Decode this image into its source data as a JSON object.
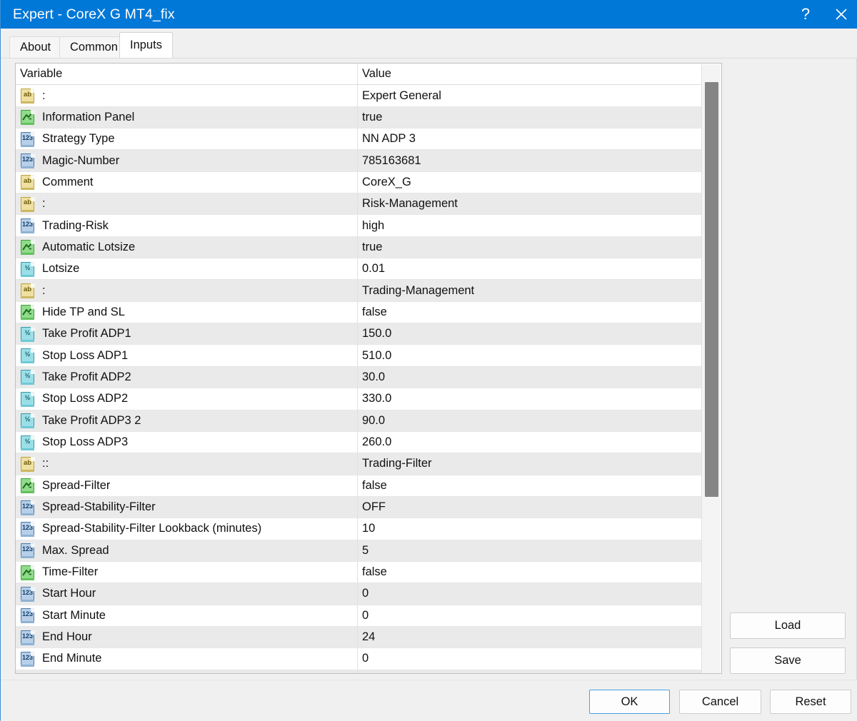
{
  "window": {
    "title": "Expert - CoreX G MT4_fix",
    "help_label": "?",
    "close_label": "close-icon",
    "accent_color": "#0078d7"
  },
  "tabs": [
    {
      "label": "About",
      "active": false
    },
    {
      "label": "Common",
      "active": false
    },
    {
      "label": "Inputs",
      "active": true
    }
  ],
  "table": {
    "headers": {
      "variable": "Variable",
      "value": "Value"
    },
    "rows": [
      {
        "icon": "string",
        "variable": ":",
        "value": "Expert General"
      },
      {
        "icon": "bool",
        "variable": "Information Panel",
        "value": "true"
      },
      {
        "icon": "int",
        "variable": "Strategy Type",
        "value": "NN ADP 3"
      },
      {
        "icon": "int",
        "variable": "Magic-Number",
        "value": "785163681"
      },
      {
        "icon": "string",
        "variable": "Comment",
        "value": "CoreX_G"
      },
      {
        "icon": "string",
        "variable": ":",
        "value": "Risk-Management"
      },
      {
        "icon": "int",
        "variable": "Trading-Risk",
        "value": "high"
      },
      {
        "icon": "bool",
        "variable": "Automatic Lotsize",
        "value": "true"
      },
      {
        "icon": "double",
        "variable": "Lotsize",
        "value": "0.01"
      },
      {
        "icon": "string",
        "variable": ":",
        "value": "Trading-Management"
      },
      {
        "icon": "bool",
        "variable": "Hide TP and SL",
        "value": "false"
      },
      {
        "icon": "double",
        "variable": "Take Profit ADP1",
        "value": "150.0"
      },
      {
        "icon": "double",
        "variable": "Stop Loss ADP1",
        "value": "510.0"
      },
      {
        "icon": "double",
        "variable": "Take Profit ADP2",
        "value": "30.0"
      },
      {
        "icon": "double",
        "variable": "Stop Loss ADP2",
        "value": "330.0"
      },
      {
        "icon": "double",
        "variable": "Take Profit ADP3 2",
        "value": "90.0"
      },
      {
        "icon": "double",
        "variable": "Stop Loss ADP3",
        "value": "260.0"
      },
      {
        "icon": "string",
        "variable": "::",
        "value": "Trading-Filter"
      },
      {
        "icon": "bool",
        "variable": "Spread-Filter",
        "value": "false"
      },
      {
        "icon": "int",
        "variable": "Spread-Stability-Filter",
        "value": "OFF"
      },
      {
        "icon": "int",
        "variable": "Spread-Stability-Filter Lookback (minutes)",
        "value": "10"
      },
      {
        "icon": "int",
        "variable": "Max. Spread",
        "value": "5"
      },
      {
        "icon": "bool",
        "variable": "Time-Filter",
        "value": "false"
      },
      {
        "icon": "int",
        "variable": "Start Hour",
        "value": "0"
      },
      {
        "icon": "int",
        "variable": "Start Minute",
        "value": "0"
      },
      {
        "icon": "int",
        "variable": "End Hour",
        "value": "24"
      },
      {
        "icon": "int",
        "variable": "End Minute",
        "value": "0"
      },
      {
        "icon": "bool",
        "variable": "",
        "value": ""
      }
    ]
  },
  "side_buttons": {
    "load": "Load",
    "save": "Save"
  },
  "footer_buttons": {
    "ok": "OK",
    "cancel": "Cancel",
    "reset": "Reset"
  },
  "icon_names": {
    "string": "string-type-icon",
    "bool": "bool-type-icon",
    "int": "integer-type-icon",
    "double": "double-type-icon"
  }
}
